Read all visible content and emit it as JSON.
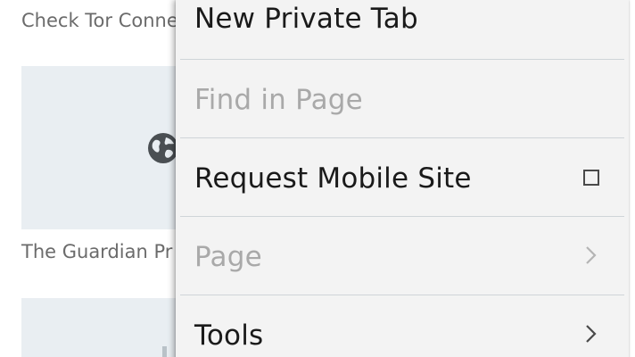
{
  "background": {
    "top_sites": [
      {
        "title": "Check Tor Conne"
      },
      {
        "title": "The Guardian Pr"
      }
    ]
  },
  "menu": {
    "items": [
      {
        "label": "New Private Tab",
        "enabled": true
      },
      {
        "label": "Find in Page",
        "enabled": false
      },
      {
        "label": "Request Mobile Site",
        "enabled": true,
        "checkbox": true,
        "checked": false
      },
      {
        "label": "Page",
        "enabled": false,
        "submenu": true
      },
      {
        "label": "Tools",
        "enabled": true,
        "submenu": true
      }
    ]
  },
  "colors": {
    "menu_background": "#f3f3f3",
    "divider": "#cfd4d8",
    "enabled_text": "#1a1a1a",
    "disabled_text": "#a9a9a9",
    "tile_background": "#e9eef2"
  }
}
